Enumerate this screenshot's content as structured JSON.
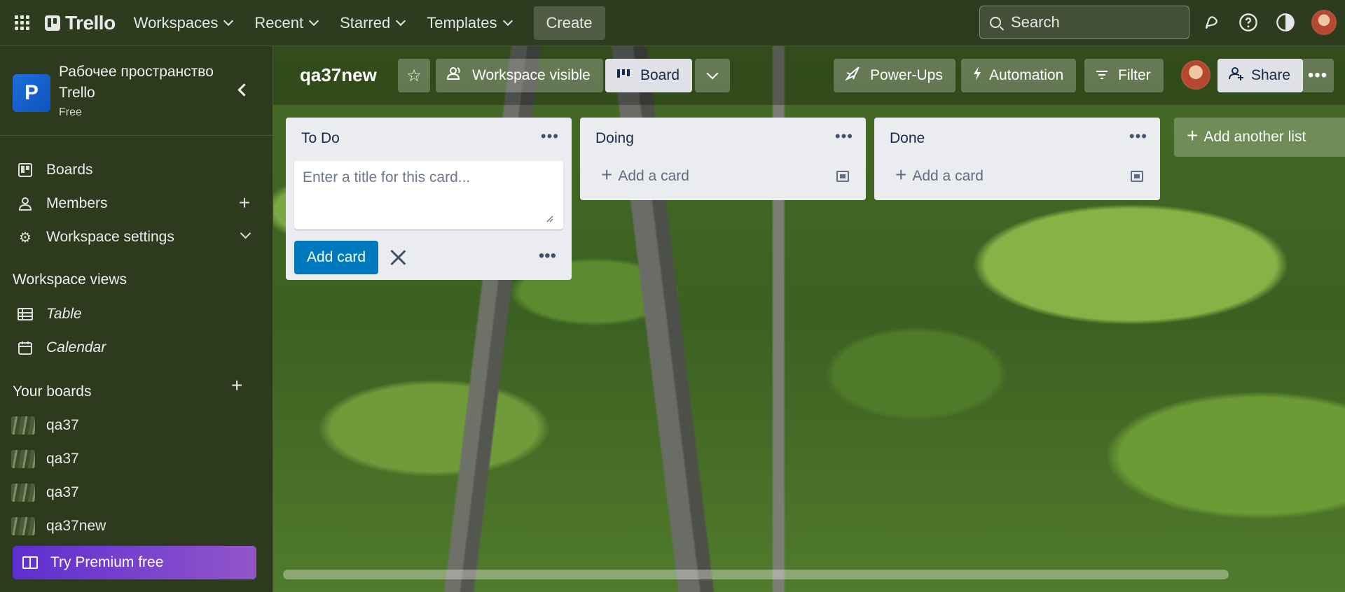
{
  "topbar": {
    "logo": "Trello",
    "nav": [
      {
        "label": "Workspaces"
      },
      {
        "label": "Recent"
      },
      {
        "label": "Starred"
      },
      {
        "label": "Templates"
      }
    ],
    "create_label": "Create",
    "search_placeholder": "Search"
  },
  "sidebar": {
    "workspace_initial": "P",
    "workspace_name": "Рабочее пространство Trello",
    "workspace_plan": "Free",
    "items": [
      {
        "label": "Boards"
      },
      {
        "label": "Members"
      },
      {
        "label": "Workspace settings"
      }
    ],
    "views_title": "Workspace views",
    "views": [
      {
        "label": "Table"
      },
      {
        "label": "Calendar"
      }
    ],
    "your_boards_title": "Your boards",
    "boards": [
      {
        "label": "qa37"
      },
      {
        "label": "qa37"
      },
      {
        "label": "qa37"
      },
      {
        "label": "qa37new"
      }
    ],
    "premium_label": "Try Premium free"
  },
  "board": {
    "title": "qa37new",
    "visibility_label": "Workspace visible",
    "view_label": "Board",
    "powerups_label": "Power-Ups",
    "automation_label": "Automation",
    "filter_label": "Filter",
    "share_label": "Share",
    "lists": [
      {
        "title": "To Do"
      },
      {
        "title": "Doing",
        "add_card": "Add a card"
      },
      {
        "title": "Done",
        "add_card": "Add a card"
      }
    ],
    "composer_placeholder": "Enter a title for this card...",
    "composer_submit": "Add card",
    "add_list_label": "Add another list"
  },
  "colors": {
    "topbar_bg": "#2d3b1f",
    "primary_button": "#0079bf",
    "workspace_badge": "#1f6fd8",
    "premium_gradient_start": "#5e2fd0",
    "premium_gradient_end": "#9255c9",
    "list_bg": "#ebecf0"
  }
}
